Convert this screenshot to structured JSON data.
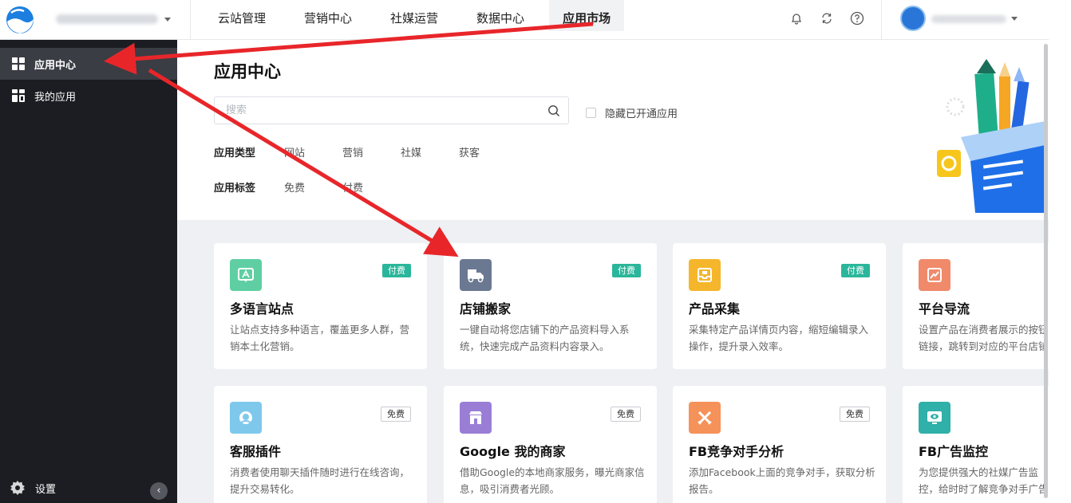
{
  "topbar": {
    "site_name": "",
    "nav": [
      {
        "label": "云站管理"
      },
      {
        "label": "营销中心"
      },
      {
        "label": "社媒运营"
      },
      {
        "label": "数据中心"
      },
      {
        "label": "应用市场",
        "active": true
      }
    ],
    "icons": [
      "bell-icon",
      "refresh-icon",
      "help-icon"
    ]
  },
  "sidebar": {
    "items": [
      {
        "label": "应用中心",
        "active": true
      },
      {
        "label": "我的应用"
      }
    ],
    "settings_label": "设置"
  },
  "main": {
    "title": "应用中心",
    "search": {
      "placeholder": "搜索",
      "value": ""
    },
    "hide_opened_label": "隐藏已开通应用",
    "filters": {
      "type_label": "应用类型",
      "types": [
        "网站",
        "营销",
        "社媒",
        "获客"
      ],
      "tag_label": "应用标签",
      "tags": [
        "免费",
        "付费"
      ]
    },
    "cards": [
      {
        "name": "多语言站点",
        "badge": "付费",
        "desc": "让站点支持多种语言，覆盖更多人群，营销本土化营销。",
        "color": "#5fcfa3",
        "icon": "language-icon"
      },
      {
        "name": "店铺搬家",
        "badge": "付费",
        "desc": "一键自动将您店铺下的产品资料导入系统，快速完成产品资料内容录入。",
        "color": "#6b7892",
        "icon": "truck-icon"
      },
      {
        "name": "产品采集",
        "badge": "付费",
        "desc": "采集特定产品详情页内容，缩短编辑录入操作，提升录入效率。",
        "color": "#f5b62c",
        "icon": "inbox-icon"
      },
      {
        "name": "平台导流",
        "badge": "",
        "desc": "设置产品在消费者展示的按钮链接，跳转到对应的平台店铺",
        "color": "#f08a6a",
        "icon": "chart-icon"
      },
      {
        "name": "客服插件",
        "badge": "免费",
        "desc": "消费者使用聊天插件随时进行在线咨询，提升交易转化。",
        "color": "#7ec8ec",
        "icon": "headset-icon"
      },
      {
        "name": "Google 我的商家",
        "badge": "免费",
        "desc": "借助Google的本地商家服务，曝光商家信息，吸引消费者光顾。",
        "color": "#9a7ed6",
        "icon": "store-icon"
      },
      {
        "name": "FB竞争对手分析",
        "badge": "免费",
        "desc": "添加Facebook上面的竞争对手，获取分析报告。",
        "color": "#f5925a",
        "icon": "swords-icon"
      },
      {
        "name": "FB广告监控",
        "badge": "",
        "desc": "为您提供强大的社媒广告监控，给时时了解竞争对手广告投放",
        "color": "#2fb0a8",
        "icon": "eye-icon"
      }
    ]
  },
  "colors": {
    "sidebar_bg": "#1b1d22",
    "accent": "#2ab69a",
    "annotation_arrow": "#e8262a"
  }
}
